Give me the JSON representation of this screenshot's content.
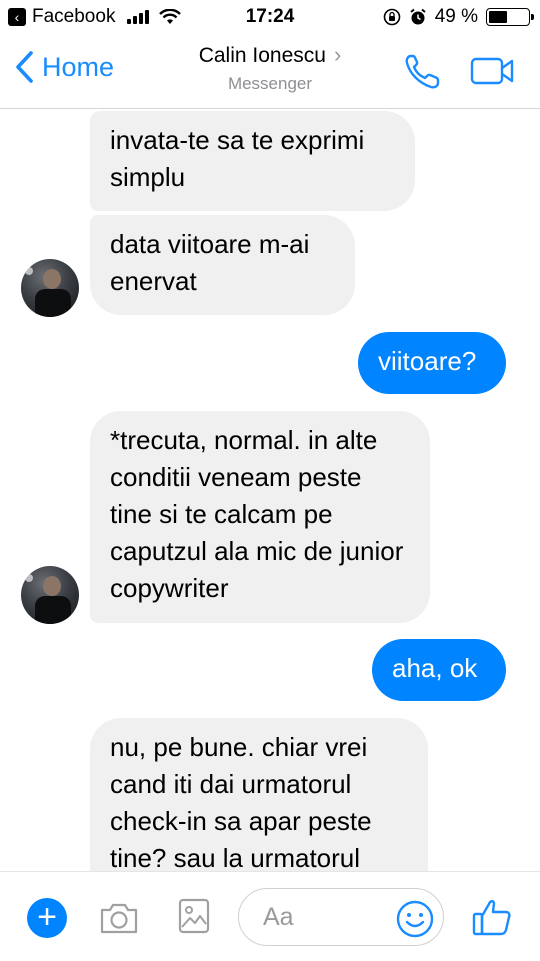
{
  "status_bar": {
    "back_app": "Facebook",
    "time": "17:24",
    "battery_percent": "49 %",
    "battery_level": 0.49
  },
  "nav": {
    "back_label": "Home",
    "contact_name": "Calin Ionescu",
    "subtitle": "Messenger"
  },
  "messages": [
    {
      "sender": "them",
      "text": "invata-te sa te exprimi simplu"
    },
    {
      "sender": "them",
      "text": "data viitoare m-ai enervat"
    },
    {
      "sender": "me",
      "text": "viitoare?"
    },
    {
      "sender": "them",
      "text": "*trecuta, normal. in alte conditii veneam peste tine si te calcam pe caputzul ala mic de junior copywriter"
    },
    {
      "sender": "me",
      "text": "aha, ok"
    },
    {
      "sender": "them",
      "text": "nu, pe bune. chiar vrei cand iti dai urmatorul check-in sa apar peste tine? sau la urmatorul"
    }
  ],
  "composer": {
    "placeholder": "Aa"
  },
  "colors": {
    "accent": "#0084ff",
    "incoming_bubble": "#f0f0f0",
    "link_blue": "#1a8cff"
  },
  "icons": {
    "back_app": "chevron-left-icon",
    "signal": "signal-bars-icon",
    "wifi": "wifi-icon",
    "orientation_lock": "orientation-lock-icon",
    "alarm": "alarm-icon",
    "battery": "battery-icon",
    "back": "chevron-left-icon",
    "phone": "phone-icon",
    "video": "video-camera-icon",
    "plus": "plus-icon",
    "camera": "camera-icon",
    "photo": "photo-icon",
    "emoji": "smiley-icon",
    "like": "thumbs-up-icon"
  }
}
